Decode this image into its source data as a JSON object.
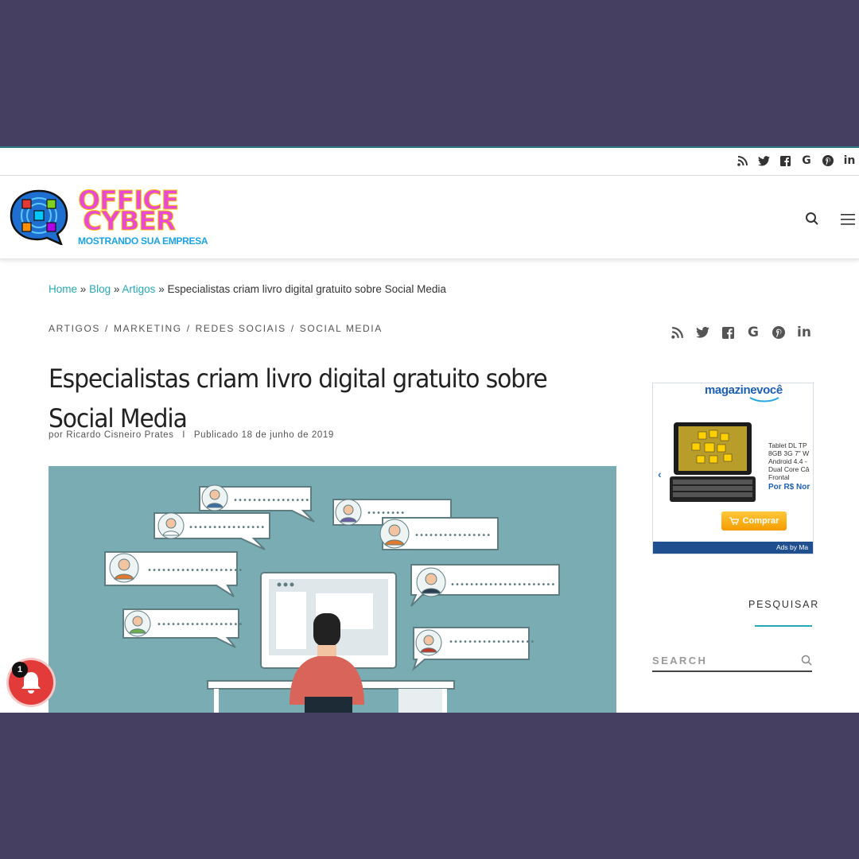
{
  "topbar": {
    "social_icons": [
      "rss-icon",
      "twitter-icon",
      "facebook-icon",
      "google-icon",
      "pinterest-icon",
      "linkedin-icon"
    ]
  },
  "logo": {
    "line1": "OFFICE",
    "line2": "CYBER",
    "tagline": "MOSTRANDO SUA EMPRESA",
    "colors": {
      "text": "#e84ad6",
      "outline": "#f6c300",
      "tagline": "#1aa3e8",
      "bubble": "#1f6fd0"
    }
  },
  "header": {
    "icons": [
      "search-icon",
      "hamburger-menu-icon"
    ]
  },
  "breadcrumb": {
    "home": "Home",
    "blog": "Blog",
    "artigos": "Artigos",
    "sep": "»",
    "current": "Especialistas criam livro digital gratuito sobre Social Media"
  },
  "post": {
    "categories": [
      "Artigos",
      "Marketing",
      "Redes Sociais",
      "Social Media"
    ],
    "cat_sep": "/",
    "title": "Especialistas criam livro digital gratuito sobre Social Media",
    "byline_prefix": "por",
    "author": "Ricardo Cisneiro Prates",
    "byline_sep": "I",
    "published_label": "Publicado",
    "published_date": "18 de junho de 2019",
    "social_icons": [
      "rss-icon",
      "twitter-icon",
      "facebook-icon",
      "google-icon",
      "pinterest-icon",
      "linkedin-icon"
    ],
    "hero_bg": "#7aadb3"
  },
  "ad": {
    "brand_1": "magazine",
    "brand_2": "você",
    "description": "Tablet DL TP\n8GB 3G 7\" W\nAndroid 4.4 -\nDual Core Câ\nFrontal",
    "price": "Por R$ Nor",
    "buy_label": "Comprar",
    "footer": "Ads by Ma",
    "accent": "#1c5fb4"
  },
  "sidebar": {
    "search_title": "PESQUISAR",
    "search_placeholder": "SEARCH",
    "accent": "#27a8b8"
  },
  "notification": {
    "count": "1",
    "color": "#e33a3a"
  }
}
